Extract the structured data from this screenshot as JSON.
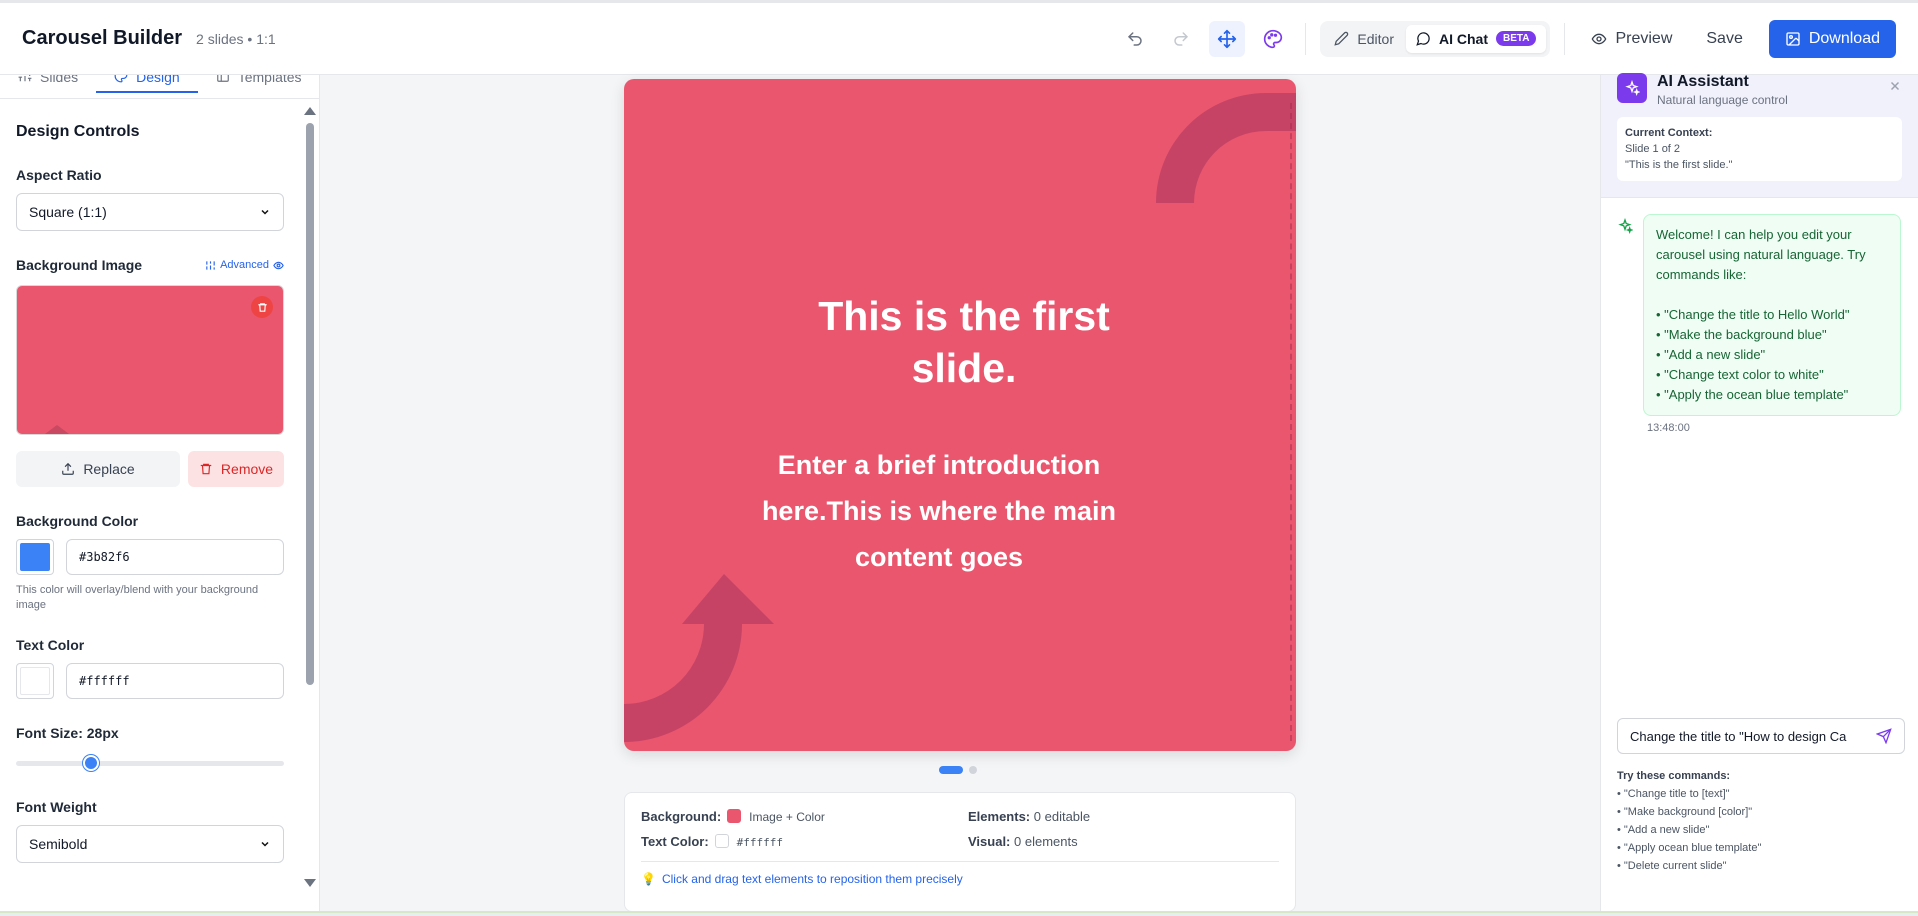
{
  "header": {
    "title": "Carousel Builder",
    "subtitle": "2 slides • 1:1",
    "mode_editor": "Editor",
    "mode_ai_chat": "AI Chat",
    "beta": "BETA",
    "preview": "Preview",
    "save": "Save",
    "download": "Download"
  },
  "left": {
    "tabs": [
      "Slides",
      "Design",
      "Templates"
    ],
    "heading": "Design Controls",
    "aspect_label": "Aspect Ratio",
    "aspect_value": "Square (1:1)",
    "bg_image_label": "Background Image",
    "advanced": "Advanced",
    "replace": "Replace",
    "remove": "Remove",
    "bg_color_label": "Background Color",
    "bg_color_value": "#3b82f6",
    "bg_color_hint": "This color will overlay/blend with your background image",
    "text_color_label": "Text Color",
    "text_color_value": "#ffffff",
    "font_size_label": "Font Size: 28px",
    "font_size_fraction": 0.28,
    "font_weight_label": "Font Weight",
    "font_weight_value": "Semibold"
  },
  "slide": {
    "title": "This is the first slide.",
    "body": "Enter a brief introduction here.This is where the main content goes",
    "bg_color": "#e9566e",
    "accent_color": "#bf3f65"
  },
  "info": {
    "background_label": "Background:",
    "background_value": "Image + Color",
    "text_color_label": "Text Color:",
    "text_color_value": "#ffffff",
    "elements_label": "Elements:",
    "elements_value": "0 editable",
    "visual_label": "Visual:",
    "visual_value": "0 elements",
    "tip": "Click and drag text elements to reposition them precisely"
  },
  "ai": {
    "title": "AI Assistant",
    "subtitle": "Natural language control",
    "context_label": "Current Context:",
    "context_slide": "Slide 1 of 2",
    "context_text": "\"This is the first slide.\"",
    "welcome": "Welcome! I can help you edit your carousel using natural language. Try commands like:\n\n• \"Change the title to Hello World\"\n• \"Make the background blue\"\n• \"Add a new slide\"\n• \"Change text color to white\"\n• \"Apply the ocean blue template\"",
    "time": "13:48:00",
    "input_value": "Change the title to \"How to design Ca",
    "commands_label": "Try these commands:",
    "commands": [
      "• \"Change title to [text]\"",
      "• \"Make background [color]\"",
      "• \"Add a new slide\"",
      "• \"Apply ocean blue template\"",
      "• \"Delete current slide\""
    ]
  }
}
